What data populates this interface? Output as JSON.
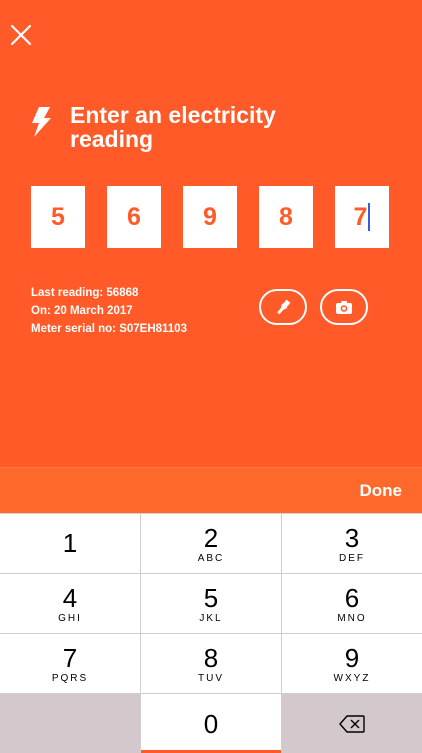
{
  "header": {
    "title": "Enter an electricity reading"
  },
  "digits": [
    "5",
    "6",
    "9",
    "8",
    "7"
  ],
  "info": {
    "last_reading": "Last reading: 56868",
    "date": "On: 20 March 2017",
    "serial": "Meter serial no: S07EH81103"
  },
  "toolbar": {
    "done_label": "Done"
  },
  "keypad": {
    "k1": {
      "num": "1",
      "letters": ""
    },
    "k2": {
      "num": "2",
      "letters": "ABC"
    },
    "k3": {
      "num": "3",
      "letters": "DEF"
    },
    "k4": {
      "num": "4",
      "letters": "GHI"
    },
    "k5": {
      "num": "5",
      "letters": "JKL"
    },
    "k6": {
      "num": "6",
      "letters": "MNO"
    },
    "k7": {
      "num": "7",
      "letters": "PQRS"
    },
    "k8": {
      "num": "8",
      "letters": "TUV"
    },
    "k9": {
      "num": "9",
      "letters": "WXYZ"
    },
    "k0": {
      "num": "0",
      "letters": ""
    }
  },
  "colors": {
    "accent": "#FF5A28",
    "cursor": "#3B5BDB"
  }
}
